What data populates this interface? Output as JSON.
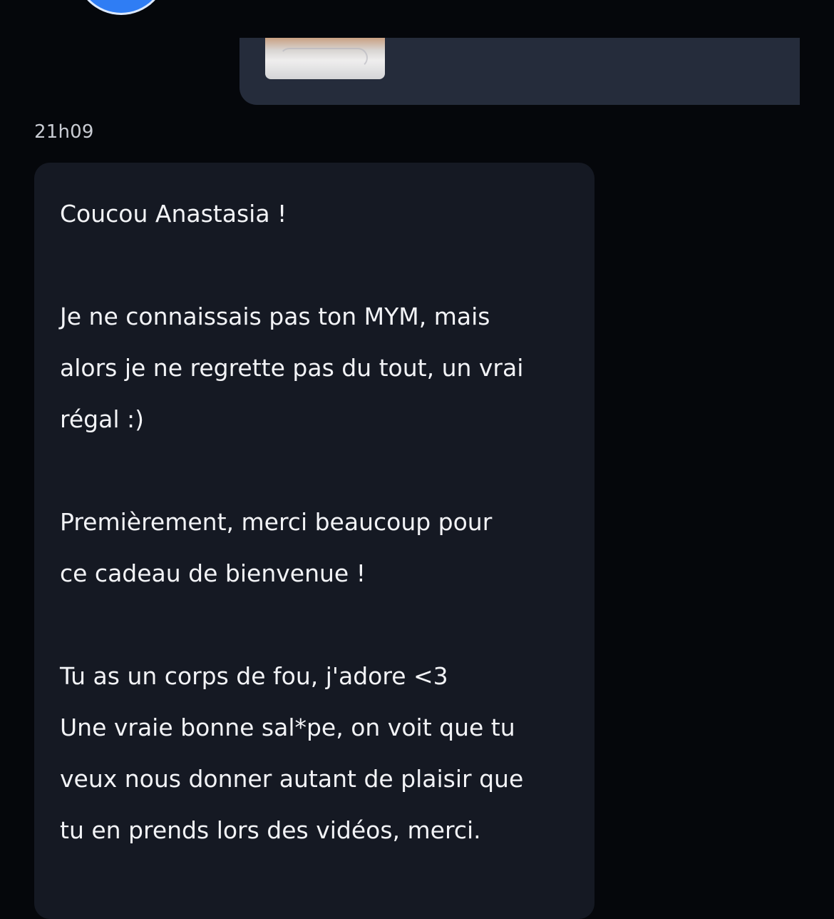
{
  "conversation": {
    "outgoing": {
      "attachment_icon": "photo-thumbnail"
    },
    "timestamp": "21h09",
    "incoming_message": {
      "lines": [
        "Coucou Anastasia !",
        "",
        "Je ne connaissais pas ton MYM, mais",
        "alors je ne regrette pas du tout, un vrai",
        "régal :)",
        "",
        "Premièrement, merci beaucoup pour",
        "ce cadeau de bienvenue !",
        "",
        "Tu as un corps de fou, j'adore <3",
        "Une vraie bonne sal*pe, on voit que tu",
        "veux nous donner autant de plaisir que",
        "tu en prends lors des vidéos, merci."
      ]
    }
  },
  "colors": {
    "background": "#05070b",
    "incoming_bubble": "#151923",
    "outgoing_bubble": "#252c3b",
    "avatar_accent": "#2f7df4",
    "text": "#f2f3f6",
    "timestamp": "#c9ccd3"
  }
}
